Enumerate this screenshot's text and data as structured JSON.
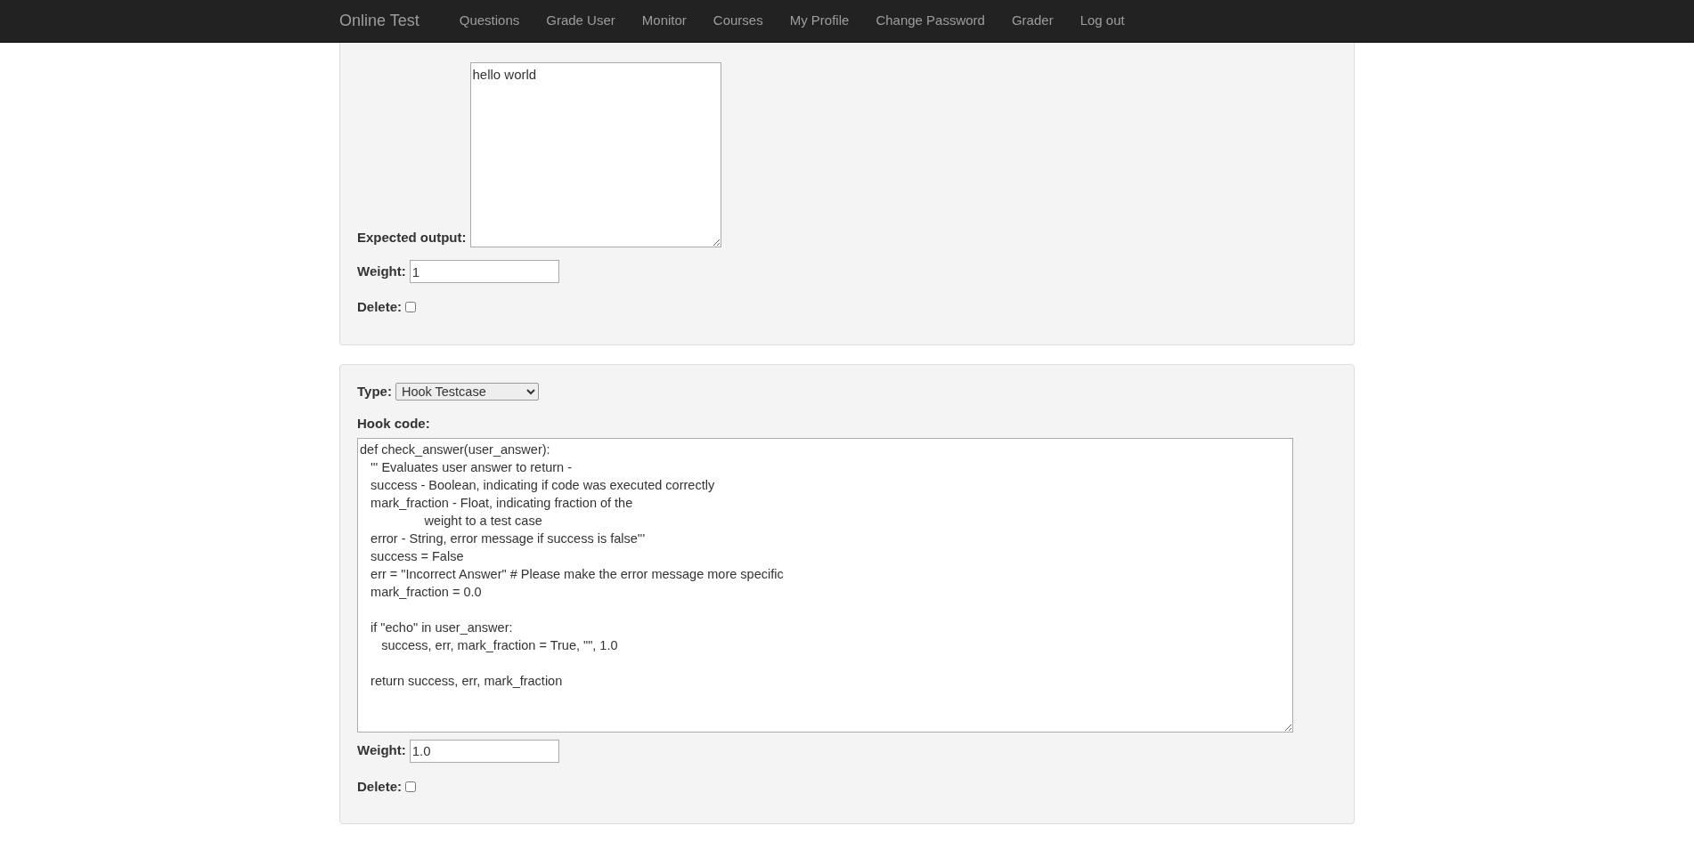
{
  "navbar": {
    "brand": "Online Test",
    "links": [
      {
        "label": "Questions"
      },
      {
        "label": "Grade User"
      },
      {
        "label": "Monitor"
      },
      {
        "label": "Courses"
      },
      {
        "label": "My Profile"
      },
      {
        "label": "Change Password"
      },
      {
        "label": "Grader"
      },
      {
        "label": "Log out"
      }
    ]
  },
  "panels": [
    {
      "kind": "stdio",
      "expected_output_label": "Expected output:",
      "expected_output": "hello world",
      "weight_label": "Weight:",
      "weight": "1",
      "delete_label": "Delete:",
      "delete_checked": false
    },
    {
      "kind": "hook",
      "type_label": "Type:",
      "type_value": "Hook Testcase",
      "code_label": "Hook code:",
      "code": "def check_answer(user_answer):\n   ''' Evaluates user answer to return -\n   success - Boolean, indicating if code was executed correctly\n   mark_fraction - Float, indicating fraction of the\n                  weight to a test case\n   error - String, error message if success is false'''\n   success = False\n   err = \"Incorrect Answer\" # Please make the error message more specific\n   mark_fraction = 0.0\n\n   if \"echo\" in user_answer:\n      success, err, mark_fraction = True, \"\", 1.0\n\n   return success, err, mark_fraction",
      "weight_label": "Weight:",
      "weight": "1.0",
      "delete_label": "Delete:",
      "delete_checked": false
    }
  ]
}
